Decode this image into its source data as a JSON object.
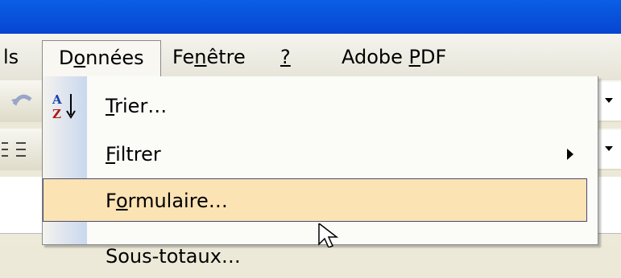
{
  "menubar": {
    "items": [
      {
        "id": "outils",
        "label": "ls"
      },
      {
        "id": "donnees",
        "label": "Données",
        "mnemonic_index": 1
      },
      {
        "id": "fenetre",
        "label": "Fenêtre",
        "mnemonic_index": 2
      },
      {
        "id": "aide",
        "label": "?"
      },
      {
        "id": "adobe",
        "label": "Adobe PDF"
      }
    ]
  },
  "menu": {
    "items": [
      {
        "label": "Trier…",
        "icon": "sort-ascending-icon",
        "submenu": false
      },
      {
        "label": "Filtrer",
        "icon": null,
        "submenu": true
      },
      {
        "label": "Formulaire…",
        "icon": null,
        "submenu": false,
        "highlighted": true
      },
      {
        "label": "Sous-totaux…",
        "icon": null,
        "submenu": false
      }
    ]
  },
  "colors": {
    "titlebar": "#0a5ee6",
    "highlight": "#fbe3b4",
    "menu_bg": "#fbfbf8"
  }
}
